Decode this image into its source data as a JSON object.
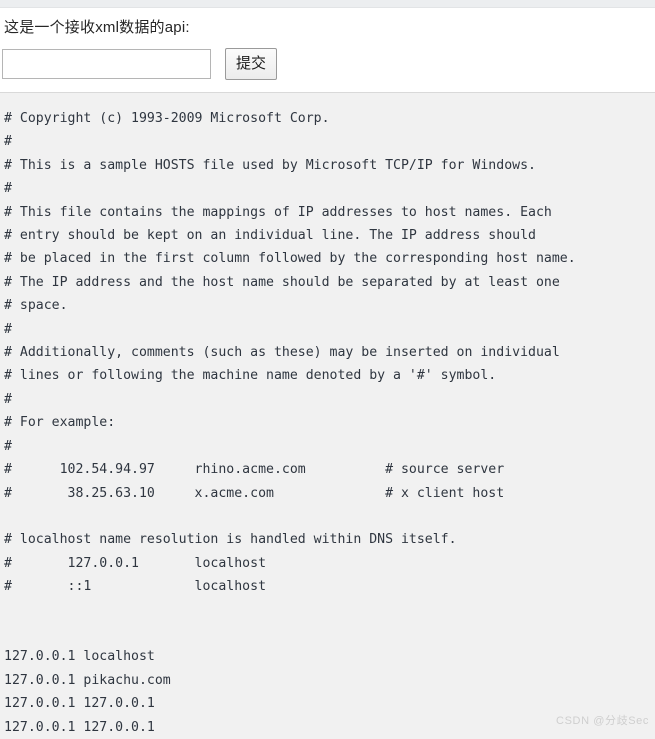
{
  "page": {
    "heading": "这是一个接收xml数据的api:",
    "watermark": "CSDN @分歧Sec"
  },
  "form": {
    "input_value": "",
    "input_placeholder": "",
    "submit_label": "提交"
  },
  "output": {
    "hosts_text": "# Copyright (c) 1993-2009 Microsoft Corp.\n#\n# This is a sample HOSTS file used by Microsoft TCP/IP for Windows.\n#\n# This file contains the mappings of IP addresses to host names. Each\n# entry should be kept on an individual line. The IP address should\n# be placed in the first column followed by the corresponding host name.\n# The IP address and the host name should be separated by at least one\n# space.\n#\n# Additionally, comments (such as these) may be inserted on individual\n# lines or following the machine name denoted by a '#' symbol.\n#\n# For example:\n#\n#      102.54.94.97     rhino.acme.com          # source server\n#       38.25.63.10     x.acme.com              # x client host\n\n# localhost name resolution is handled within DNS itself.\n#       127.0.0.1       localhost\n#       ::1             localhost\n\n\n127.0.0.1 localhost\n127.0.0.1 pikachu.com\n127.0.0.1 127.0.0.1\n127.0.0.1 127.0.0.1"
  }
}
